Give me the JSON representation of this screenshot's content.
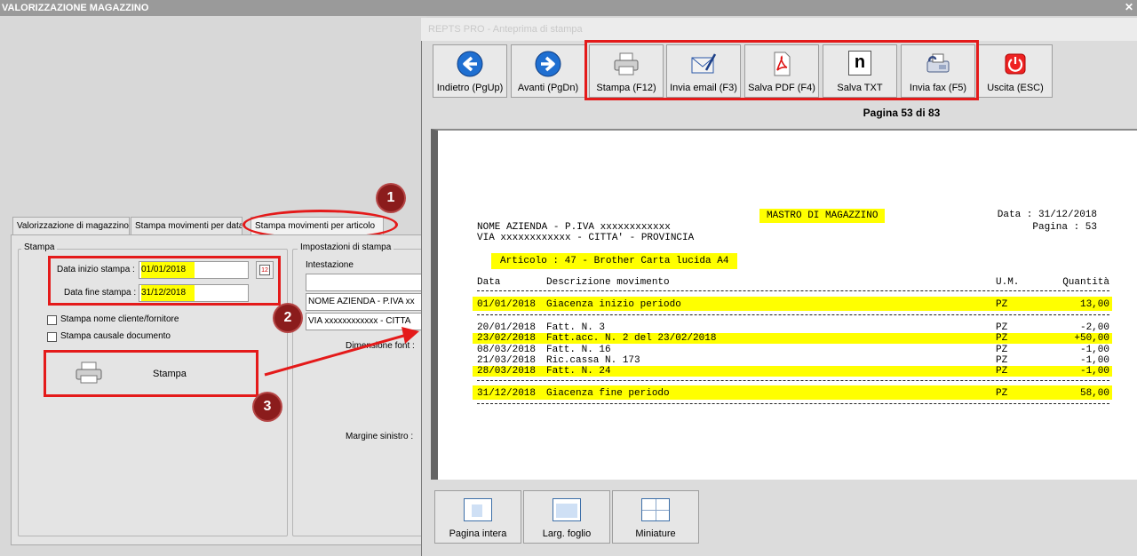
{
  "main_window": {
    "title": "VALORIZZAZIONE MAGAZZINO",
    "tabs": [
      {
        "label": "Valorizzazione di magazzino"
      },
      {
        "label": "Stampa movimenti per data"
      },
      {
        "label": "Stampa movimenti per articolo"
      }
    ],
    "stampa_group": {
      "legend": "Stampa",
      "data_inizio_label": "Data inizio stampa :",
      "data_inizio_value": "01/01/2018",
      "data_fine_label": "Data fine stampa :",
      "data_fine_value": "31/12/2018",
      "calendar_day": "12",
      "chk_cliente_label": "Stampa nome cliente/fornitore",
      "chk_causale_label": "Stampa causale documento",
      "stampa_button": "Stampa"
    },
    "impostazioni_group": {
      "legend": "Impostazioni di stampa",
      "intestazione_label": "Intestazione",
      "line1": "",
      "line2": "NOME AZIENDA - P.IVA xx",
      "line3": "VIA xxxxxxxxxxxx - CITTA",
      "dimensione_font_label": "Dimensione font :",
      "margine_sinistro_label": "Margine sinistro :"
    }
  },
  "annotations": {
    "badge1": "1",
    "badge2": "2",
    "badge3": "3"
  },
  "preview_window": {
    "title": "REPTS PRO - Anteprima di stampa",
    "toolbar": [
      {
        "label": "Indietro (PgUp)",
        "icon": "arrow-left-icon"
      },
      {
        "label": "Avanti (PgDn)",
        "icon": "arrow-right-icon"
      },
      {
        "label": "Stampa (F12)",
        "icon": "printer-icon"
      },
      {
        "label": "Invia email (F3)",
        "icon": "email-icon"
      },
      {
        "label": "Salva PDF (F4)",
        "icon": "pdf-icon"
      },
      {
        "label": "Salva TXT",
        "icon": "txt-icon"
      },
      {
        "label": "Invia fax (F5)",
        "icon": "fax-icon"
      },
      {
        "label": "Uscita (ESC)",
        "icon": "power-icon"
      }
    ],
    "txt_icon_letter": "n",
    "page_indicator": "Pagina 53 di 83",
    "report": {
      "title": "MASTRO DI MAGAZZINO",
      "company_line1": "NOME AZIENDA - P.IVA xxxxxxxxxxxx",
      "company_line2": "VIA xxxxxxxxxxxx - CITTA' - PROVINCIA",
      "date_line": "Data : 31/12/2018",
      "page_line": "Pagina : 53",
      "article": "Articolo : 47 - Brother Carta lucida A4",
      "headers": {
        "date": "Data",
        "desc": "Descrizione movimento",
        "um": "U.M.",
        "qty": "Quantità"
      },
      "opening": {
        "date": "01/01/2018",
        "desc": "Giacenza inizio periodo",
        "um": "PZ",
        "qty": "13,00"
      },
      "rows": [
        {
          "date": "20/01/2018",
          "desc": "Fatt. N. 3",
          "um": "PZ",
          "qty": "-2,00"
        },
        {
          "date": "23/02/2018",
          "desc": "Fatt.acc. N. 2 del 23/02/2018",
          "um": "PZ",
          "qty": "+50,00"
        },
        {
          "date": "08/03/2018",
          "desc": "Fatt. N. 16",
          "um": "PZ",
          "qty": "-1,00"
        },
        {
          "date": "21/03/2018",
          "desc": "Ric.cassa N. 173",
          "um": "PZ",
          "qty": "-1,00"
        },
        {
          "date": "28/03/2018",
          "desc": "Fatt. N. 24",
          "um": "PZ",
          "qty": "-1,00"
        }
      ],
      "closing": {
        "date": "31/12/2018",
        "desc": "Giacenza fine periodo",
        "um": "PZ",
        "qty": "58,00"
      }
    },
    "view_buttons": [
      {
        "label": "Pagina intera"
      },
      {
        "label": "Larg. foglio"
      },
      {
        "label": "Miniature"
      }
    ]
  }
}
